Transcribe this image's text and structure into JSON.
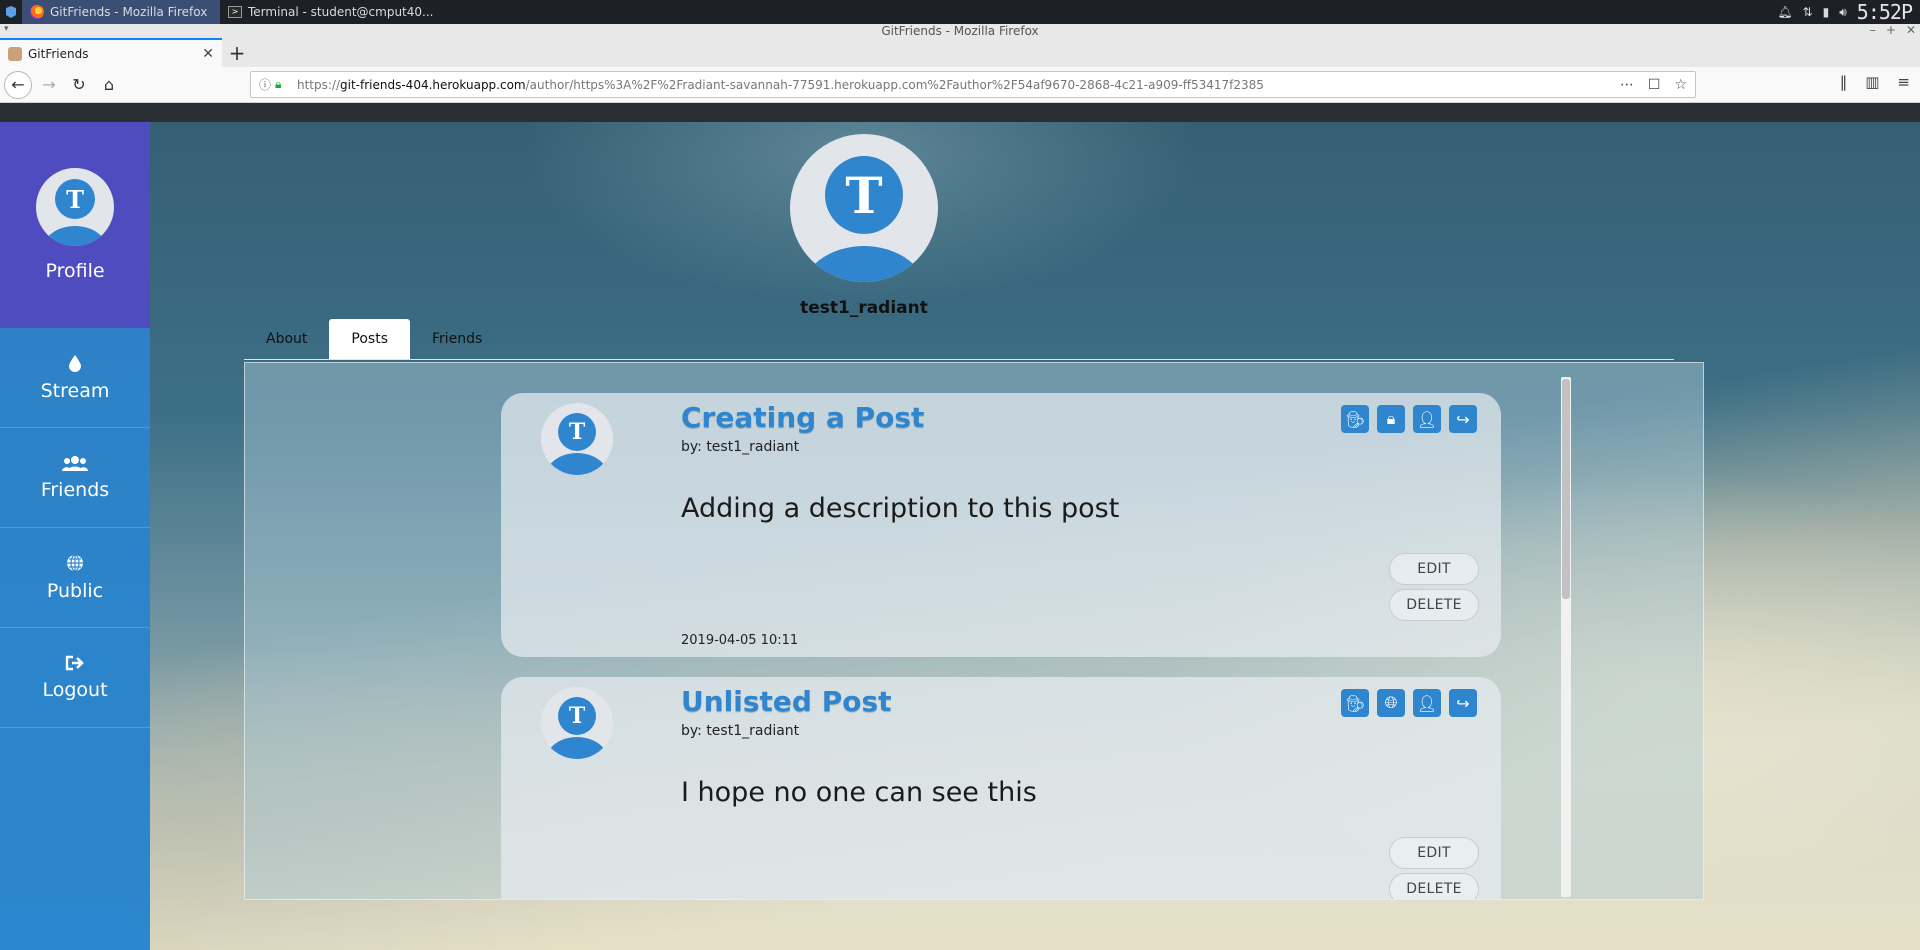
{
  "os": {
    "tasks": [
      {
        "label": "GitFriends - Mozilla Firefox"
      },
      {
        "label": "Terminal - student@cmput40..."
      }
    ],
    "clock": "5:52P"
  },
  "browser": {
    "window_title": "GitFriends - Mozilla Firefox",
    "tab_title": "GitFriends",
    "url_host": "git-friends-404.herokuapp.com",
    "url_prefix": "https://",
    "url_path": "/author/https%3A%2F%2Fradiant-savannah-77591.herokuapp.com%2Fauthor%2F54af9670-2868-4c21-a909-ff53417f2385"
  },
  "sidebar": {
    "profile_label": "Profile",
    "avatar_letter": "T",
    "items": [
      {
        "label": "Stream",
        "icon": "droplet-icon"
      },
      {
        "label": "Friends",
        "icon": "users-icon"
      },
      {
        "label": "Public",
        "icon": "globe-icon"
      },
      {
        "label": "Logout",
        "icon": "sign-out-icon"
      }
    ]
  },
  "profile": {
    "avatar_letter": "T",
    "username": "test1_radiant",
    "tabs": [
      "About",
      "Posts",
      "Friends"
    ],
    "active_tab": "Posts"
  },
  "posts": [
    {
      "title": "Creating a Post",
      "author": "by: test1_radiant",
      "description": "Adding a description to this post",
      "icons": [
        "user-secret-icon",
        "lock-icon",
        "contact-card-icon",
        "share-icon"
      ],
      "edit_label": "EDIT",
      "delete_label": "DELETE",
      "timestamp": "2019-04-05 10:11"
    },
    {
      "title": "Unlisted Post",
      "author": "by: test1_radiant",
      "description": "I hope no one can see this",
      "icons": [
        "user-secret-icon",
        "globe-icon",
        "contact-card-icon",
        "share-icon"
      ],
      "edit_label": "EDIT",
      "delete_label": "DELETE"
    }
  ],
  "colors": {
    "accent": "#2f86cf",
    "sidebar_profile": "#4e4cbe",
    "sidebar": "#2b87cf"
  }
}
